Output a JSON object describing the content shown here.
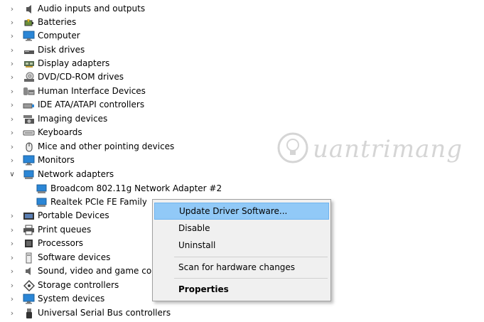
{
  "tree": {
    "items": [
      {
        "label": "Audio inputs and outputs",
        "icon": "speaker-icon"
      },
      {
        "label": "Batteries",
        "icon": "battery-icon"
      },
      {
        "label": "Computer",
        "icon": "computer-icon"
      },
      {
        "label": "Disk drives",
        "icon": "disk-drive-icon"
      },
      {
        "label": "Display adapters",
        "icon": "display-adapter-icon"
      },
      {
        "label": "DVD/CD-ROM drives",
        "icon": "dvd-drive-icon"
      },
      {
        "label": "Human Interface Devices",
        "icon": "hid-icon"
      },
      {
        "label": "IDE ATA/ATAPI controllers",
        "icon": "ide-controller-icon"
      },
      {
        "label": "Imaging devices",
        "icon": "camera-icon"
      },
      {
        "label": "Keyboards",
        "icon": "keyboard-icon"
      },
      {
        "label": "Mice and other pointing devices",
        "icon": "mouse-icon"
      },
      {
        "label": "Monitors",
        "icon": "monitor-icon"
      },
      {
        "label": "Network adapters",
        "icon": "network-adapter-icon",
        "expanded": true
      },
      {
        "label": "Portable Devices",
        "icon": "portable-device-icon"
      },
      {
        "label": "Print queues",
        "icon": "printer-icon"
      },
      {
        "label": "Processors",
        "icon": "processor-icon"
      },
      {
        "label": "Software devices",
        "icon": "software-device-icon"
      },
      {
        "label": "Sound, video and game con",
        "icon": "sound-icon"
      },
      {
        "label": "Storage controllers",
        "icon": "storage-controller-icon"
      },
      {
        "label": "System devices",
        "icon": "system-device-icon"
      },
      {
        "label": "Universal Serial Bus controllers",
        "icon": "usb-icon"
      }
    ],
    "network_children": [
      {
        "label": "Broadcom 802.11g Network Adapter #2",
        "icon": "network-adapter-icon"
      },
      {
        "label": "Realtek PCIe FE Family C",
        "icon": "network-adapter-icon"
      }
    ]
  },
  "context_menu": {
    "items": [
      {
        "label": "Update Driver Software...",
        "highlighted": true
      },
      {
        "label": "Disable"
      },
      {
        "label": "Uninstall"
      },
      {
        "label": "Scan for hardware changes"
      },
      {
        "label": "Properties",
        "bold": true
      }
    ]
  },
  "colors": {
    "menu_highlight": "#91c9f7",
    "menu_background": "#f0f0f0",
    "icon_blue": "#2b86d6"
  },
  "watermark": {
    "text": "uantrimang"
  }
}
